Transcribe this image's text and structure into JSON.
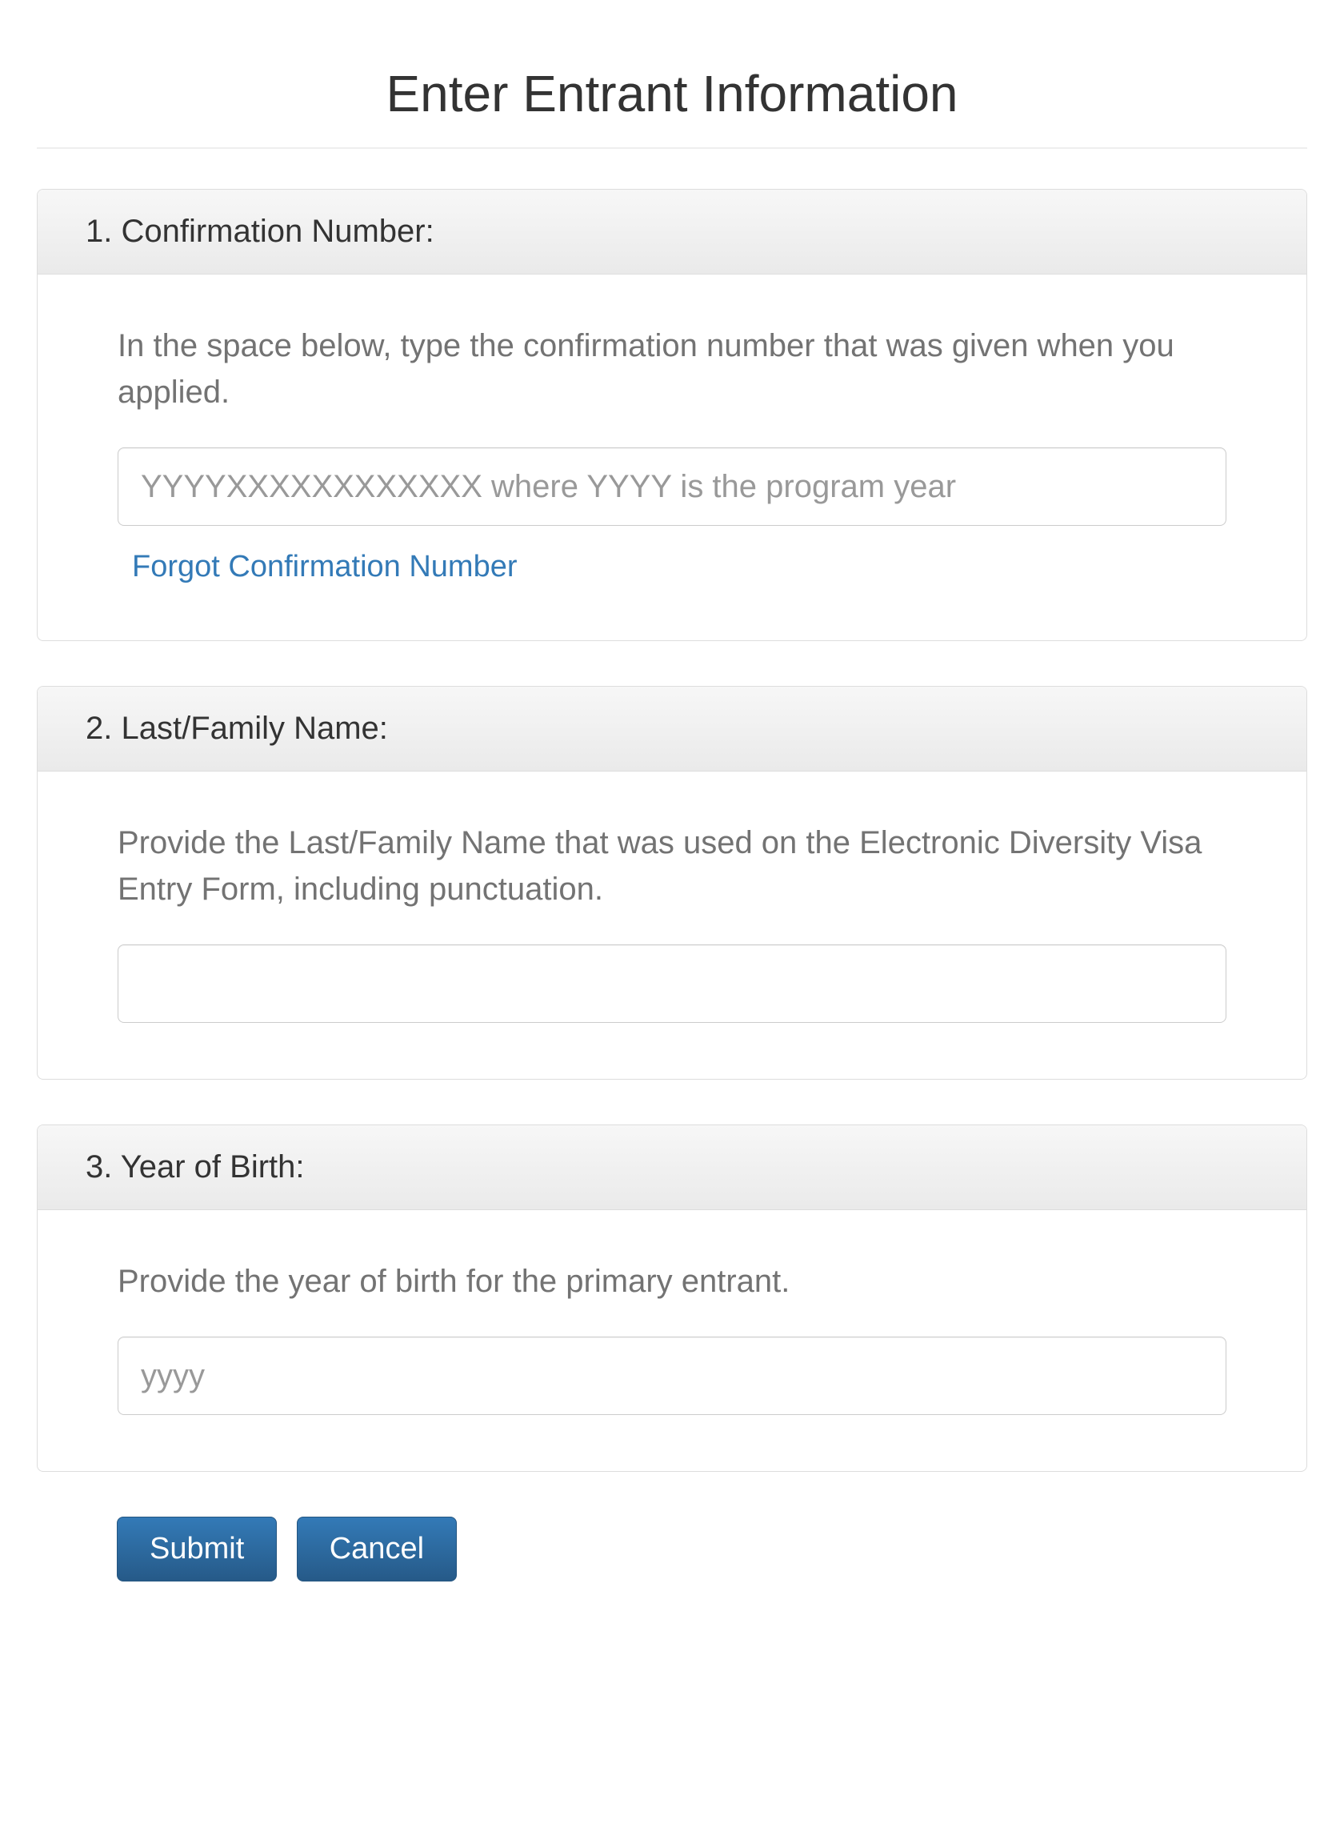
{
  "page": {
    "title": "Enter Entrant Information"
  },
  "sections": {
    "confirmation": {
      "heading": "1. Confirmation Number:",
      "help": "In the space below, type the confirmation number that was given when you applied.",
      "placeholder": "YYYYXXXXXXXXXXXX where YYYY is the program year",
      "value": "",
      "forgot_link": "Forgot Confirmation Number"
    },
    "lastname": {
      "heading": "2. Last/Family Name:",
      "help": "Provide the Last/Family Name that was used on the Electronic Diversity Visa Entry Form, including punctuation.",
      "placeholder": "",
      "value": ""
    },
    "yob": {
      "heading": "3. Year of Birth:",
      "help": "Provide the year of birth for the primary entrant.",
      "placeholder": "yyyy",
      "value": ""
    }
  },
  "buttons": {
    "submit": "Submit",
    "cancel": "Cancel"
  }
}
